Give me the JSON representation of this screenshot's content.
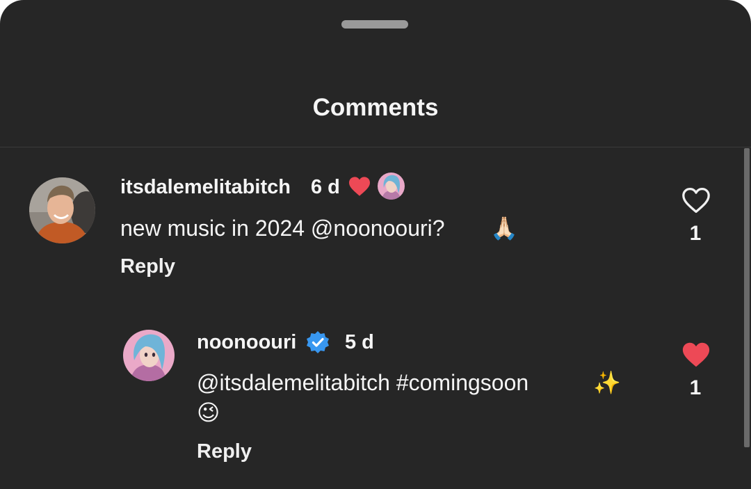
{
  "sheet": {
    "title": "Comments"
  },
  "comments": [
    {
      "username": "itsdalemelitabitch",
      "time": "6 d",
      "creator_liked": true,
      "text": "new music in 2024 @noonoouri?",
      "text_emoji": "🙏🏻",
      "reply_label": "Reply",
      "liked": false,
      "like_count": "1"
    },
    {
      "username": "noonoouri",
      "verified": true,
      "time": "5 d",
      "text": "@itsdalemelitabitch #comingsoon",
      "text_emoji": "✨",
      "second_line_emoji": "😉",
      "reply_label": "Reply",
      "liked": true,
      "like_count": "1"
    }
  ],
  "icons": {
    "like_outline": "heart-outline-icon",
    "like_filled": "heart-filled-icon",
    "creator_heart": "creator-heart-icon",
    "verified": "verified-badge-icon"
  },
  "colors": {
    "background": "#262626",
    "text": "#f5f5f5",
    "like_red": "#ed4956",
    "verified_blue": "#3897f0"
  }
}
